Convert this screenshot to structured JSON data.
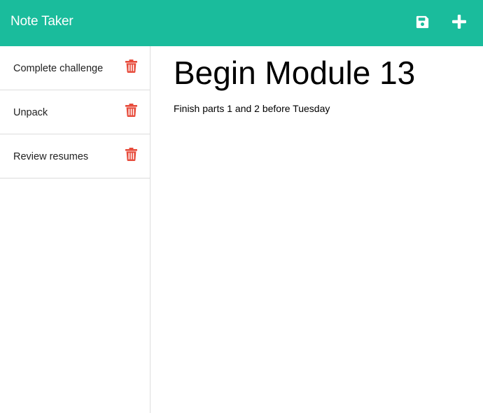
{
  "navbar": {
    "brand": "Note Taker",
    "background": "#1abc9c",
    "save_icon": "floppy-disk-icon",
    "new_icon": "plus-icon"
  },
  "notes": [
    {
      "title": "Complete challenge",
      "delete_icon": "trash-icon"
    },
    {
      "title": "Unpack",
      "delete_icon": "trash-icon"
    },
    {
      "title": "Review resumes",
      "delete_icon": "trash-icon"
    }
  ],
  "editor": {
    "title": "Begin Module 13",
    "body": "Finish parts 1 and 2 before Tuesday"
  },
  "colors": {
    "accent": "#1abc9c",
    "delete": "#e74c3c"
  }
}
